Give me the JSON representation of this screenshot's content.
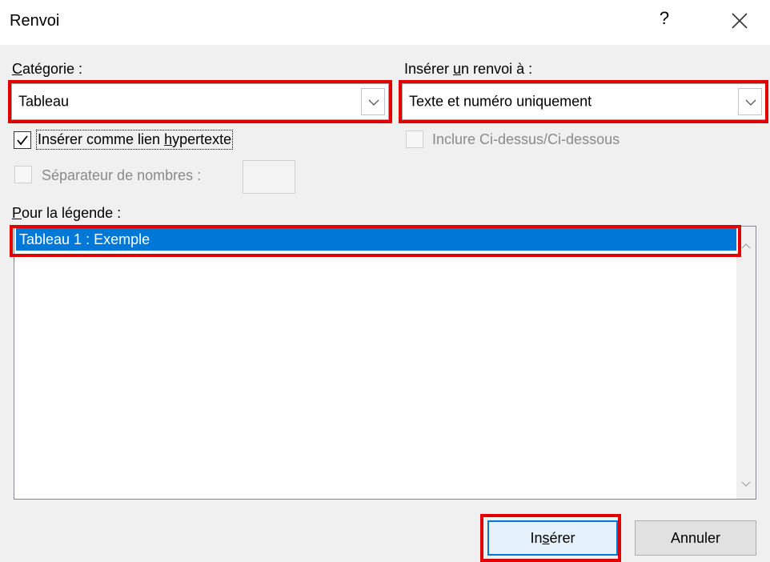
{
  "dialog": {
    "title": "Renvoi",
    "help_label": "?"
  },
  "category": {
    "label_prefix": "",
    "label_access": "C",
    "label_rest": "atégorie :",
    "value": "Tableau"
  },
  "reference_type": {
    "label_prefix": "Insérer ",
    "label_access": "u",
    "label_rest": "n renvoi à :",
    "value": "Texte et numéro uniquement"
  },
  "options": {
    "hyperlink_label_prefix": "Insérer comme lien ",
    "hyperlink_label_access": "h",
    "hyperlink_label_rest": "ypertexte",
    "hyperlink_checked": true,
    "above_below_label": "Inclure Ci-dessus/Ci-dessous",
    "separator_label": "Séparateur de nombres :"
  },
  "caption_list": {
    "label_access": "P",
    "label_rest": "our la légende :",
    "items": [
      "Tableau 1 : Exemple"
    ]
  },
  "buttons": {
    "insert_prefix": "In",
    "insert_access": "s",
    "insert_rest": "érer",
    "cancel": "Annuler"
  },
  "colors": {
    "highlight": "#e00000",
    "selection": "#0078d7"
  }
}
